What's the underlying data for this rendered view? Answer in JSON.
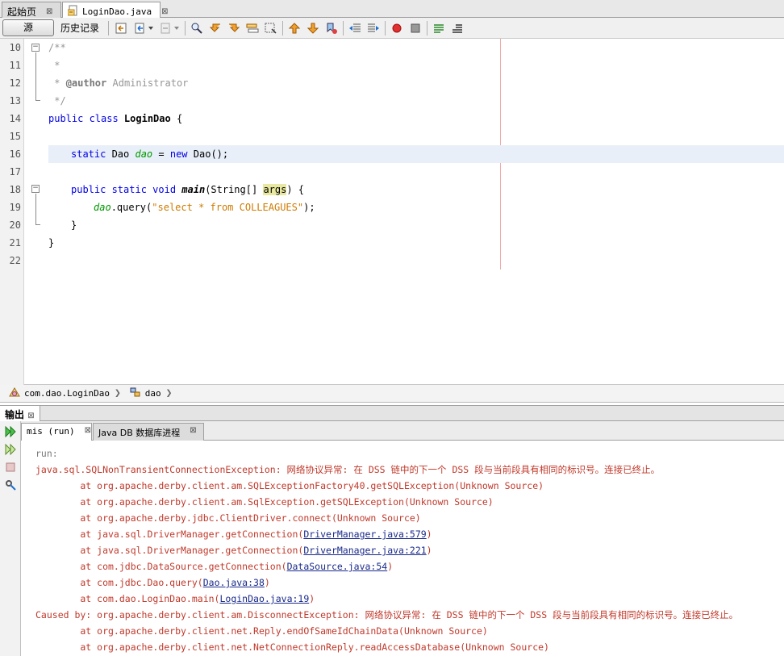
{
  "editor_tabs": [
    {
      "label": "起始页",
      "close": "⊠"
    },
    {
      "label": "LoginDao.java",
      "close": "⊠"
    }
  ],
  "toolbar": {
    "source_label": "源",
    "history_label": "历史记录"
  },
  "editor": {
    "line_numbers": [
      "10",
      "11",
      "12",
      "13",
      "14",
      "15",
      "16",
      "17",
      "18",
      "19",
      "20",
      "21",
      "22"
    ],
    "code": {
      "l10": "/**",
      "l11": " *",
      "l12_prefix": " * ",
      "l12_tag": "@author",
      "l12_rest": " Administrator",
      "l13": " */",
      "l14_kw": "public class ",
      "l14_cls": "LoginDao",
      "l14_rest": " {",
      "l16_kw": "static",
      "l16_type": " Dao ",
      "l16_field": "dao",
      "l16_eq": " = ",
      "l16_new": "new",
      "l16_rest": " Dao();",
      "l18_kw": "public static void ",
      "l18_method": "main",
      "l18_mid": "(String[] ",
      "l18_param": "args",
      "l18_rest": ") {",
      "l19_field": "dao",
      "l19_call": ".query(",
      "l19_str": "\"select * from COLLEAGUES\"",
      "l19_rest": ");",
      "l20": "}",
      "l21": "}"
    }
  },
  "breadcrumb": {
    "package": "com.dao.LoginDao",
    "member": "dao"
  },
  "output": {
    "title": "输出",
    "title_close": "⊠",
    "tabs": [
      {
        "label": "mis (run)",
        "close": "⊠"
      },
      {
        "label": "Java DB 数据库进程",
        "close": "⊠"
      }
    ],
    "lines": {
      "run": "run:",
      "e1": "java.sql.SQLNonTransientConnectionException: 网络协议异常: 在 DSS 链中的下一个 DSS 段与当前段具有相同的标识号。连接已终止。",
      "s1": "        at org.apache.derby.client.am.SQLExceptionFactory40.getSQLException(Unknown Source)",
      "s2": "        at org.apache.derby.client.am.SqlException.getSQLException(Unknown Source)",
      "s3": "        at org.apache.derby.jdbc.ClientDriver.connect(Unknown Source)",
      "s4a": "        at java.sql.DriverManager.getConnection(",
      "s4l": "DriverManager.java:579",
      "s5a": "        at java.sql.DriverManager.getConnection(",
      "s5l": "DriverManager.java:221",
      "s6a": "        at com.jdbc.DataSource.getConnection(",
      "s6l": "DataSource.java:54",
      "s7a": "        at com.jdbc.Dao.query(",
      "s7l": "Dao.java:38",
      "s8a": "        at com.dao.LoginDao.main(",
      "s8l": "LoginDao.java:19",
      "close_paren": ")",
      "e2": "Caused by: org.apache.derby.client.am.DisconnectException: 网络协议异常: 在 DSS 链中的下一个 DSS 段与当前段具有相同的标识号。连接已终止。",
      "s9": "        at org.apache.derby.client.net.Reply.endOfSameIdChainData(Unknown Source)",
      "s10": "        at org.apache.derby.client.net.NetConnectionReply.readAccessDatabase(Unknown Source)"
    }
  },
  "colors": {
    "keyword": "#0000e6",
    "string": "#ce7b00",
    "field": "#009900",
    "comment": "#969696",
    "error": "#c0392b",
    "link": "#1a2a8a"
  }
}
